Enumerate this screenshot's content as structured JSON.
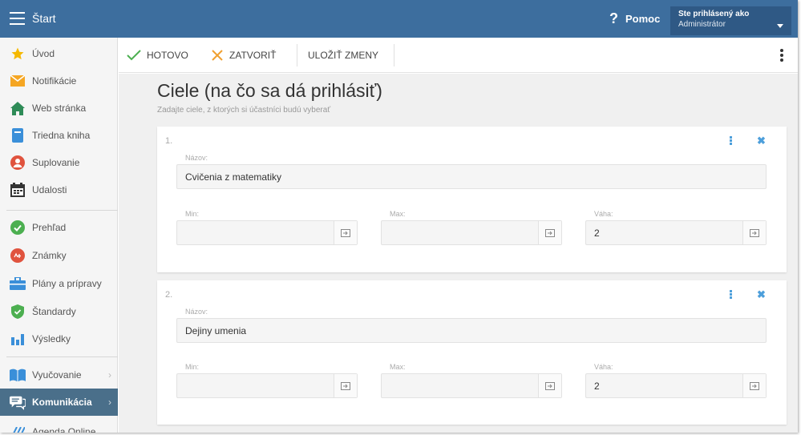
{
  "topbar": {
    "title": "Štart",
    "help_icon": "?",
    "help_label": "Pomoc",
    "user_line1": "Ste prihlásený ako",
    "user_line2": "Administrátor"
  },
  "sidebar": {
    "items": [
      {
        "label": "Úvod",
        "icon": "star-icon",
        "color": "#f5b800"
      },
      {
        "label": "Notifikácie",
        "icon": "envelope-icon",
        "color": "#f5a623"
      },
      {
        "label": "Web stránka",
        "icon": "home-icon",
        "color": "#2e8b57"
      },
      {
        "label": "Triedna kniha",
        "icon": "book-icon",
        "color": "#3a8fd9"
      },
      {
        "label": "Suplovanie",
        "icon": "person-icon",
        "color": "#e0533e"
      },
      {
        "label": "Udalosti",
        "icon": "calendar-icon",
        "color": "#333333"
      },
      {
        "label": "Prehľad",
        "icon": "check-circle-icon",
        "color": "#4caf50"
      },
      {
        "label": "Známky",
        "icon": "grades-icon",
        "color": "#e0533e"
      },
      {
        "label": "Plány a prípravy",
        "icon": "briefcase-icon",
        "color": "#3a8fd9"
      },
      {
        "label": "Štandardy",
        "icon": "shield-check-icon",
        "color": "#4caf50"
      },
      {
        "label": "Výsledky",
        "icon": "bar-chart-icon",
        "color": "#3a8fd9"
      },
      {
        "label": "Vyučovanie",
        "icon": "open-book-icon",
        "color": "#3a8fd9"
      },
      {
        "label": "Komunikácia",
        "icon": "chat-icon",
        "color": "#ffffff"
      },
      {
        "label": "Agenda Online",
        "icon": "agenda-icon",
        "color": "#3a8fd9"
      }
    ]
  },
  "toolbar": {
    "done_label": "HOTOVO",
    "close_label": "ZATVORIŤ",
    "save_label": "ULOŽIŤ ZMENY"
  },
  "main": {
    "title": "Ciele (na čo sa dá prihlásiť)",
    "subtitle": "Zadajte ciele, z ktorých si účastníci budú vyberať",
    "cards": [
      {
        "number": "1.",
        "name_label": "Názov:",
        "name_value": "Cvičenia z matematiky",
        "min_label": "Min:",
        "min_value": "",
        "max_label": "Max:",
        "max_value": "",
        "weight_label": "Váha:",
        "weight_value": "2"
      },
      {
        "number": "2.",
        "name_label": "Názov:",
        "name_value": "Dejiny umenia",
        "min_label": "Min:",
        "min_value": "",
        "max_label": "Max:",
        "max_value": "",
        "weight_label": "Váha:",
        "weight_value": "2"
      }
    ]
  },
  "colors": {
    "topbar": "#3d6e9e",
    "accent": "#4d9fdb",
    "active_nav": "#4a6f8a",
    "check_green": "#4caf50",
    "close_orange": "#f0a030"
  }
}
